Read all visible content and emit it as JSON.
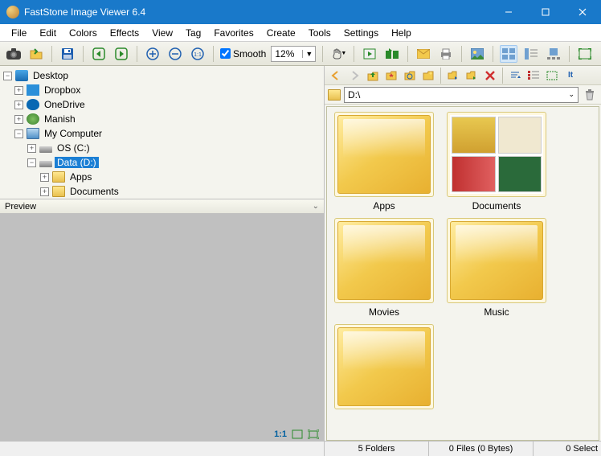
{
  "window": {
    "title": "FastStone Image Viewer 6.4"
  },
  "menubar": [
    "File",
    "Edit",
    "Colors",
    "Effects",
    "View",
    "Tag",
    "Favorites",
    "Create",
    "Tools",
    "Settings",
    "Help"
  ],
  "toolbar": {
    "smooth_label": "Smooth",
    "smooth_checked": true,
    "zoom_value": "12%"
  },
  "tree": {
    "nodes": [
      {
        "label": "Desktop",
        "icon": "desktop",
        "indent": 0,
        "expander": "-"
      },
      {
        "label": "Dropbox",
        "icon": "dropbox",
        "indent": 1,
        "expander": "+"
      },
      {
        "label": "OneDrive",
        "icon": "onedrive",
        "indent": 1,
        "expander": "+"
      },
      {
        "label": "Manish",
        "icon": "user",
        "indent": 1,
        "expander": "+"
      },
      {
        "label": "My Computer",
        "icon": "computer",
        "indent": 1,
        "expander": "-"
      },
      {
        "label": "OS (C:)",
        "icon": "drive",
        "indent": 2,
        "expander": "+"
      },
      {
        "label": "Data (D:)",
        "icon": "drive",
        "indent": 2,
        "expander": "-",
        "selected": true
      },
      {
        "label": "Apps",
        "icon": "folder",
        "indent": 3,
        "expander": "+"
      },
      {
        "label": "Documents",
        "icon": "folder",
        "indent": 3,
        "expander": "+"
      }
    ]
  },
  "preview": {
    "header_label": "Preview",
    "ratio_label": "1:1"
  },
  "path": {
    "value": "D:\\"
  },
  "thumbnails": [
    {
      "label": "Apps",
      "type": "folder"
    },
    {
      "label": "Documents",
      "type": "previews"
    },
    {
      "label": "Movies",
      "type": "folder"
    },
    {
      "label": "Music",
      "type": "folder"
    },
    {
      "label": "",
      "type": "folder"
    }
  ],
  "statusbar": {
    "folders": "5 Folders",
    "files": "0 Files (0 Bytes)",
    "selected": "0 Select"
  }
}
